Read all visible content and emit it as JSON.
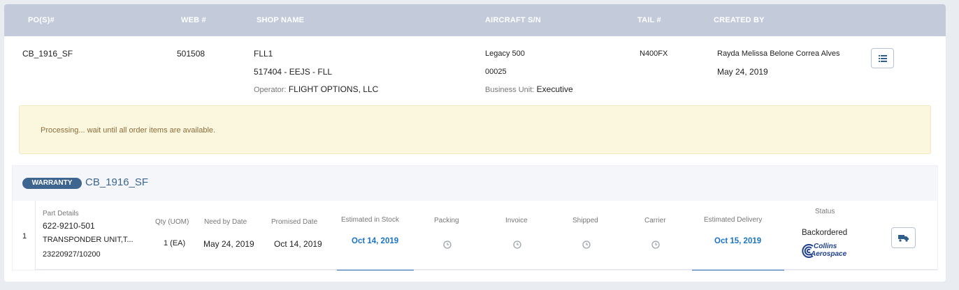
{
  "header": {
    "col_pos": "PO(S)#",
    "col_web": "WEB #",
    "col_shop": "SHOP NAME",
    "col_aircraft": "AIRCRAFT S/N",
    "col_tail": "TAIL #",
    "col_created": "CREATED BY"
  },
  "record": {
    "po": "CB_1916_SF",
    "web": "501508",
    "shop_name": "FLL1",
    "shop_code": "517404 - EEJS - FLL",
    "operator_label": "Operator:",
    "operator_value": "FLIGHT OPTIONS, LLC",
    "aircraft_model": "Legacy 500",
    "aircraft_sn": "00025",
    "business_unit_label": "Business Unit:",
    "business_unit_value": "Executive",
    "tail": "N400FX",
    "created_by": "Rayda Melissa Belone Correa Alves",
    "created_date": "May 24, 2019",
    "list_icon": "list-icon"
  },
  "alert": {
    "message": "Processing... wait until all order items are available."
  },
  "order": {
    "badge": "WARRANTY",
    "title": "CB_1916_SF",
    "columns": {
      "part_details": "Part Details",
      "qty": "Qty (UOM)",
      "need_by": "Need by Date",
      "promised": "Promised Date",
      "est_stock": "Estimated in Stock",
      "packing": "Packing",
      "invoice": "Invoice",
      "shipped": "Shipped",
      "carrier": "Carrier",
      "est_delivery": "Estimated Delivery",
      "status": "Status"
    },
    "item": {
      "index": "1",
      "part_number": "622-9210-501",
      "description": "TRANSPONDER UNIT,T...",
      "ref": "23220927/10200",
      "qty": "1 (EA)",
      "need_by": "May 24, 2019",
      "promised": "Oct 14, 2019",
      "est_stock": "Oct 14, 2019",
      "est_delivery": "Oct 15, 2019",
      "status": "Backordered",
      "supplier_logo_line1": "Collins",
      "supplier_logo_line2": "Aerospace",
      "pending_icon": "clock-icon",
      "action_icon": "truck-icon"
    }
  },
  "colors": {
    "header_bg": "#c3cbdb",
    "badge_bg": "#3e6590",
    "link": "#1a73c7",
    "alert_bg": "#fbf6de",
    "alert_text": "#8a6d3b"
  }
}
